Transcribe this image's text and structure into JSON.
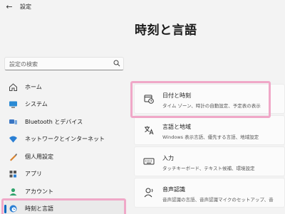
{
  "titlebar": {
    "back_icon": "back-arrow-icon",
    "app_title": "設定"
  },
  "page": {
    "title": "時刻と言語"
  },
  "search": {
    "placeholder": "設定の検索",
    "icon": "search-icon"
  },
  "sidebar": {
    "items": [
      {
        "label": "ホーム",
        "icon": "home-icon"
      },
      {
        "label": "システム",
        "icon": "system-icon"
      },
      {
        "label": "Bluetooth とデバイス",
        "icon": "bluetooth-icon"
      },
      {
        "label": "ネットワークとインターネット",
        "icon": "network-icon"
      },
      {
        "label": "個人用設定",
        "icon": "personalization-icon"
      },
      {
        "label": "アプリ",
        "icon": "apps-icon"
      },
      {
        "label": "アカウント",
        "icon": "account-icon"
      },
      {
        "label": "時刻と言語",
        "icon": "time-language-icon",
        "selected": true
      }
    ]
  },
  "cards": [
    {
      "title": "日付と時刻",
      "subtitle": "タイム ゾーン、時計の自動設定、予定表の表示",
      "icon": "clock-icon"
    },
    {
      "title": "言語と地域",
      "subtitle": "Windows 表示言語、優先する言語、地域設定",
      "icon": "language-icon"
    },
    {
      "title": "入力",
      "subtitle": "タッチキーボード、テキスト候補、環境設定",
      "icon": "keyboard-icon"
    },
    {
      "title": "音声認識",
      "subtitle": "音声認識の言語、音声認識マイクのセットアップ、音",
      "icon": "speech-icon"
    }
  ],
  "colors": {
    "accent": "#0067c0",
    "highlight": "#f0a8c8",
    "background": "#f3f3f3"
  }
}
